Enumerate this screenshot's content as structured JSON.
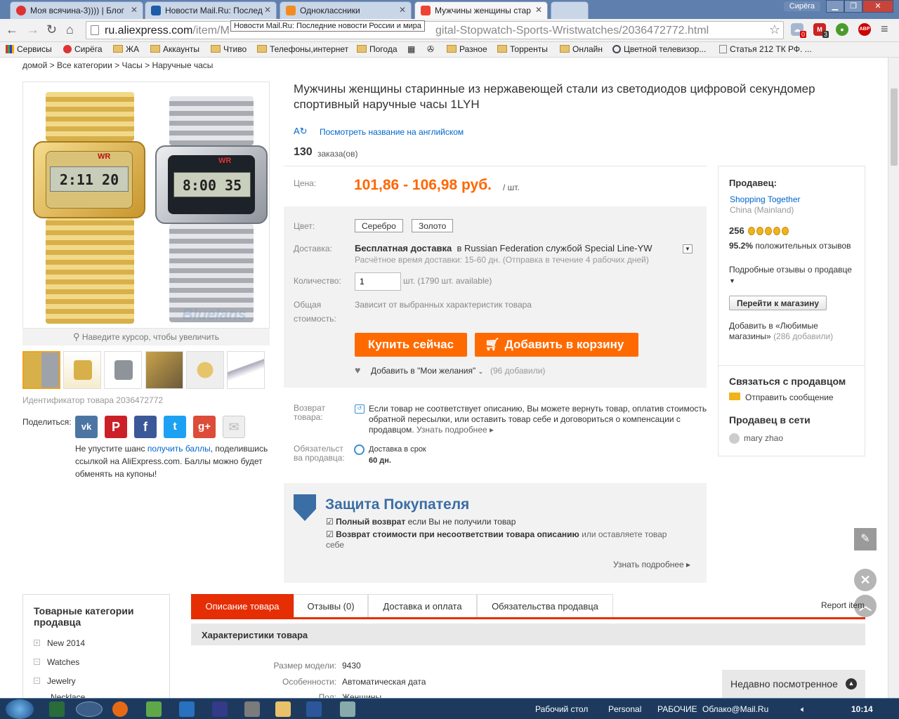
{
  "browser": {
    "tabs": [
      {
        "label": "Моя всячина-3)))) | Блог",
        "favicon_color": "#d33"
      },
      {
        "label": "Новости Mail.Ru: Послед",
        "favicon_color": "#1d5ca8"
      },
      {
        "label": "Одноклассники",
        "favicon_color": "#f18d20"
      },
      {
        "label": "Мужчины женщины стар",
        "favicon_color": "#e43"
      }
    ],
    "profile_label": "Сирёга",
    "url_host": "ru.aliexpress.com",
    "url_path_left": "/item/M",
    "url_path_right": "gital-Stopwatch-Sports-Wristwatches/2036472772.html",
    "tooltip": "Новости Mail.Ru: Последние новости России и мира",
    "ext_badges": [
      "0",
      "3"
    ],
    "ext_abp": "ABP",
    "bookmarks": [
      "Сервисы",
      "Сирёга",
      "ЖА",
      "Аккаунты",
      "Чтиво",
      "Телефоны,интернет",
      "Погода",
      "Разное",
      "Торренты",
      "Онлайн",
      "Цветной телевизор...",
      "Статья 212 ТК РФ. ..."
    ]
  },
  "breadcrumb": "домой > Все категории > Часы > Наручные часы",
  "product": {
    "title": "Мужчины женщины старинные из нержавеющей стали из светодиодов цифровой секундомер спортивный наручные часы 1LYH",
    "translate_link": "Посмотреть название на английском",
    "orders_count": "130",
    "orders_label": "заказа(ов)",
    "watch_brand": "WR",
    "watch_time_gold": "2:11 20",
    "watch_time_silver": "8:00 35",
    "watermark": "Bluelans",
    "zoom_hint": "Наведите курсор, чтобы увеличить",
    "product_id": "Идентификатор товара 2036472772",
    "price_label": "Цена:",
    "price": "101,86 - 106,98 руб.",
    "price_unit": "/ шт.",
    "color_label": "Цвет:",
    "colors": [
      "Серебро",
      "Золото"
    ],
    "delivery_label": "Доставка:",
    "delivery_free": "Бесплатная доставка",
    "delivery_in": "в",
    "delivery_service": "Russian Federation службой Special Line-YW",
    "delivery_time": "Расчётное время доставки: 15-60 дн. (Отправка в течение 4 рабочих дней)",
    "qty_label": "Количество:",
    "qty_value": "1",
    "qty_available": "шт. (1790 шт. available)",
    "total_label_1": "Общая",
    "total_label_2": "стоимость:",
    "total_value": "Зависит от выбранных характеристик товара",
    "buy_now": "Купить сейчас",
    "add_cart": "Добавить в корзину",
    "wishlist": "Добавить в \"Мои желания\"",
    "wishlist_count": "(96 добавили)",
    "return_label_1": "Возврат",
    "return_label_2": "товара:",
    "return_text": "Если товар не соответствует описанию, Вы можете вернуть товар, оплатив стоимость обратной пересылки, или оставить товар себе и договориться о компенсации с продавцом.",
    "return_more": "Узнать подробнее",
    "obligation_label_1": "Обязательст",
    "obligation_label_2": "ва продавца:",
    "obligation_text": "Доставка в срок",
    "obligation_days": "60 дн.",
    "share_label": "Поделиться:",
    "share_promo_1": "Не упустите шанс",
    "share_promo_link": "получить баллы",
    "share_promo_2": ", поделившись ссылкой на AliExpress.com. Баллы можно будет обменять на купоны!"
  },
  "protection": {
    "title": "Защита Покупателя",
    "item1_bold": "Полный возврат",
    "item1_rest": "если Вы не получили товар",
    "item2_bold": "Возврат стоимости при несоответствии товара описанию",
    "item2_rest": "или оставляете товар себе",
    "more": "Узнать подробнее"
  },
  "seller": {
    "heading": "Продавец:",
    "name": "Shopping Together",
    "country": "China (Mainland)",
    "score": "256",
    "positive_pct": "95.2%",
    "positive_text": "положительных отзывов",
    "detail_feedback": "Подробные отзывы о продавце",
    "goto_store": "Перейти к магазину",
    "fav_store": "Добавить в «Любимые магазины»",
    "fav_count": "(286 добавили)",
    "contact_heading": "Связаться с продавцом",
    "send_message": "Отправить сообщение",
    "online_heading": "Продавец в сети",
    "online_name": "mary zhao"
  },
  "categories": {
    "heading": "Товарные категории продавца",
    "items": [
      "New 2014",
      "Watches",
      "Jewelry",
      "Necklace"
    ]
  },
  "detail_tabs": [
    "Описание товара",
    "Отзывы (0)",
    "Доставка и оплата",
    "Обязательства продавца"
  ],
  "report_item": "Report item",
  "specs": {
    "heading": "Характеристики товара",
    "rows": [
      {
        "k": "Размер модели:",
        "v": "9430"
      },
      {
        "k": "Особенности:",
        "v": "Автоматическая дата"
      },
      {
        "k": "Пол:",
        "v": "Женщины"
      }
    ]
  },
  "recently_viewed": "Недавно посмотренное",
  "taskbar": {
    "items": [
      "Рабочий стол",
      "Personal",
      "РАБОЧИЕ",
      "Облако@Mail.Ru"
    ],
    "clock": "10:14"
  }
}
